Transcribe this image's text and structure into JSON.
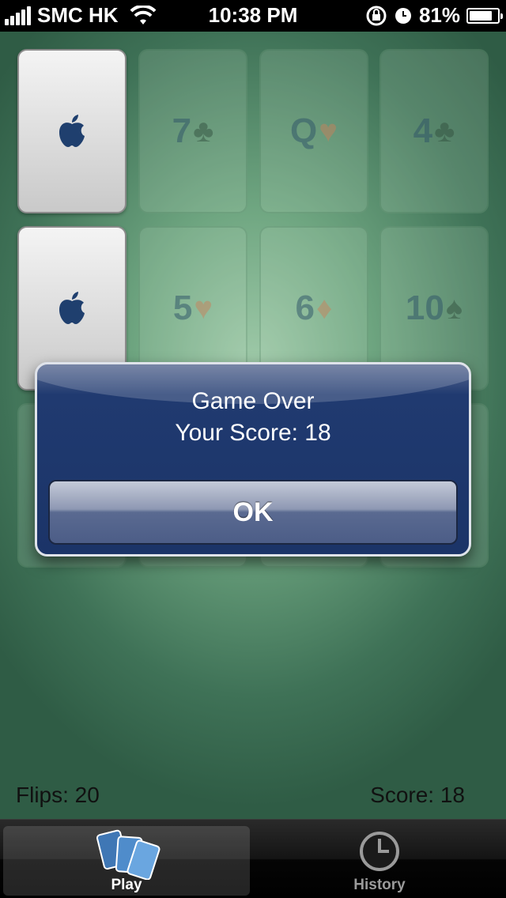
{
  "status_bar": {
    "carrier": "SMC HK",
    "time": "10:38 PM",
    "battery": "81%",
    "battery_level": 0.81
  },
  "cards": [
    {
      "state": "face-down",
      "icon": "apple-icon"
    },
    {
      "state": "matched",
      "rank": "7",
      "suit": "♣",
      "suit_color": "black"
    },
    {
      "state": "matched",
      "rank": "Q",
      "suit": "♥",
      "suit_color": "red"
    },
    {
      "state": "matched",
      "rank": "4",
      "suit": "♣",
      "suit_color": "black"
    },
    {
      "state": "face-down",
      "icon": "apple-icon"
    },
    {
      "state": "matched",
      "rank": "5",
      "suit": "♥",
      "suit_color": "red"
    },
    {
      "state": "matched",
      "rank": "6",
      "suit": "♦",
      "suit_color": "red"
    },
    {
      "state": "matched",
      "rank": "10",
      "suit": "♠",
      "suit_color": "black"
    },
    {
      "state": "matched",
      "rank": "",
      "suit": "",
      "suit_color": "black"
    },
    {
      "state": "matched",
      "rank": "",
      "suit": "",
      "suit_color": "black"
    },
    {
      "state": "matched",
      "rank": "",
      "suit": "",
      "suit_color": "red"
    },
    {
      "state": "matched",
      "rank": "",
      "suit": "",
      "suit_color": "black"
    }
  ],
  "footer": {
    "flips": "Flips: 20",
    "score": "Score: 18"
  },
  "alert": {
    "title": "Game Over",
    "message": "Your Score: 18",
    "ok_label": "OK"
  },
  "tabs": [
    {
      "label": "Play",
      "icon": "cards-icon",
      "selected": true
    },
    {
      "label": "History",
      "icon": "clock-icon",
      "selected": false
    }
  ],
  "colors": {
    "table_green": "#4f8a66",
    "alert_blue": "#1b3468",
    "card_back_apple": "#1f3f6e"
  }
}
